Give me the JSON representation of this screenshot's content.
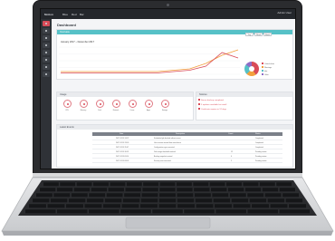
{
  "topbar": {
    "app_name": "Motion",
    "chips": [
      "Blue",
      "Red",
      "Bar"
    ],
    "user": "Admin User"
  },
  "page": {
    "title": "Dashboard"
  },
  "activity_card": {
    "header": "Overview",
    "range_tabs": [
      "Day",
      "Week",
      "Month"
    ],
    "chart_title": "January 2017 – December 2017",
    "legend": [
      {
        "label": "Critical alerts",
        "color": "#d94b58"
      },
      {
        "label": "Warnings",
        "color": "#f2a03d"
      },
      {
        "label": "Info",
        "color": "#56c1c7"
      },
      {
        "label": "Other",
        "color": "#8e6cc6"
      }
    ]
  },
  "usage_card": {
    "header": "Usage",
    "gauges": [
      "CPU",
      "Memory",
      "Disk",
      "Network",
      "Users",
      "Apps",
      "Storage"
    ]
  },
  "notices_card": {
    "header": "Notices",
    "items": [
      "Server backup completed",
      "3 updates available for install",
      "Certificate expires in 12 days"
    ]
  },
  "events_card": {
    "header": "Latest Events",
    "columns": [
      "Date",
      "Description",
      "Count",
      "Status"
    ],
    "rows": [
      {
        "date": "2017-12-18 14:22",
        "desc": "Scheduled job finished without errors",
        "count": "",
        "status": "Completed"
      },
      {
        "date": "2017-12-18 13:05",
        "desc": "User session started from new device",
        "count": "",
        "status": "Completed"
      },
      {
        "date": "2017-12-18 11:47",
        "desc": "Configuration sync executed",
        "count": "",
        "status": "Completed"
      },
      {
        "date": "2017-12-18 10:31",
        "desc": "Disk usage threshold reached",
        "count": "12",
        "status": "Pending review"
      },
      {
        "date": "2017-12-18 09:14",
        "desc": "Backup snapshot created",
        "count": "4",
        "status": "Pending review"
      },
      {
        "date": "2017-12-18 08:02",
        "desc": "Security scan executed",
        "count": "2",
        "status": "Pending review"
      }
    ]
  },
  "chart_data": {
    "type": "line",
    "x": [
      1,
      2,
      3,
      4,
      5,
      6,
      7,
      8,
      9,
      10,
      11,
      12
    ],
    "series": [
      {
        "name": "",
        "color": "#f2a03d",
        "values": [
          2,
          2,
          2,
          2,
          2,
          2,
          2,
          3,
          4,
          8,
          14,
          18
        ]
      },
      {
        "name": "",
        "color": "#d94b58",
        "values": [
          1,
          1,
          1,
          1,
          1,
          1,
          1,
          2,
          3,
          6,
          16,
          12
        ]
      }
    ],
    "ylim": [
      0,
      20
    ],
    "grid": true
  }
}
